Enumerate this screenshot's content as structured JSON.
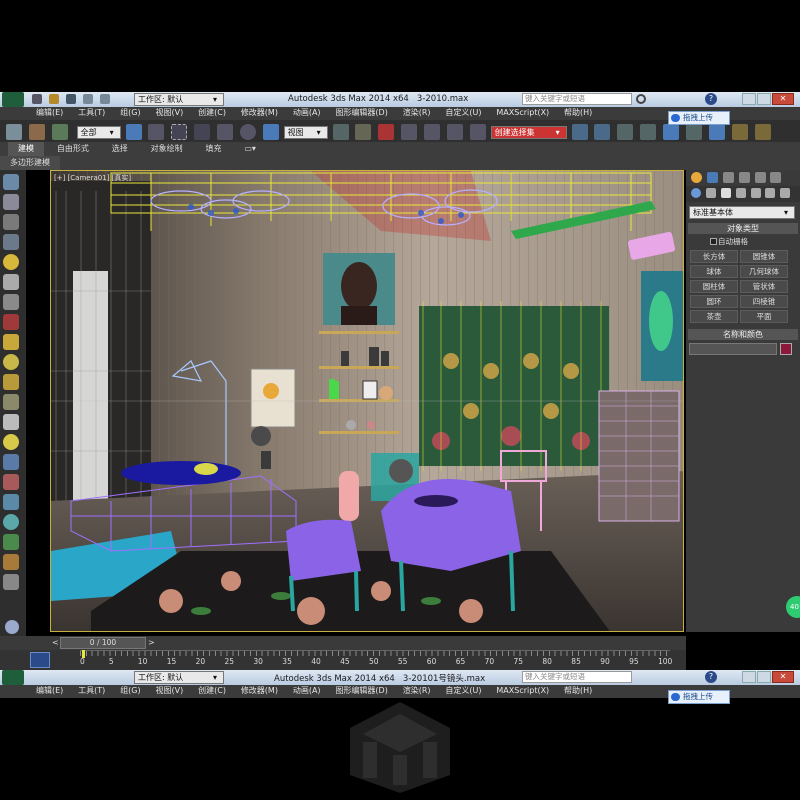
{
  "top": {
    "titlebar": {
      "workspace_label": "工作区: 默认",
      "app_title": "Autodesk 3ds Max  2014 x64",
      "file_name": "3-2010.max",
      "search_placeholder": "键入关键字或短语"
    },
    "menu": [
      "编辑(E)",
      "工具(T)",
      "组(G)",
      "视图(V)",
      "创建(C)",
      "修改器(M)",
      "动画(A)",
      "图形编辑器(D)",
      "渲染(R)",
      "自定义(U)",
      "MAXScript(X)",
      "帮助(H)"
    ],
    "toolbar": {
      "selection_filter": "全部",
      "ref_coord": "视图",
      "selection_set": "创建选择集",
      "cloud_upload": "拖拽上传"
    },
    "ribbon_tabs": [
      "建模",
      "自由形式",
      "选择",
      "对象绘制",
      "填充"
    ],
    "ribbon_sub": "多边形建模",
    "viewport_label": "[+] [Camera01] [真实]"
  },
  "command_panel": {
    "dropdown": "标准基本体",
    "object_type_title": "对象类型",
    "autogrid_label": "自动栅格",
    "buttons": [
      "长方体",
      "圆锥体",
      "球体",
      "几何球体",
      "圆柱体",
      "管状体",
      "圆环",
      "四棱锥",
      "茶壶",
      "平面"
    ],
    "name_color_title": "名称和颜色",
    "object_color": "#8b1a3a"
  },
  "timeline": {
    "frame_counter": "0 / 100",
    "ticks": [
      "0",
      "5",
      "10",
      "15",
      "20",
      "25",
      "30",
      "35",
      "40",
      "45",
      "50",
      "55",
      "60",
      "65",
      "70",
      "75",
      "80",
      "85",
      "90",
      "95",
      "100"
    ]
  },
  "bottom": {
    "titlebar": {
      "workspace_label": "工作区: 默认",
      "app_title": "Autodesk 3ds Max  2014 x64",
      "file_name": "3-20101号镜头.max",
      "search_placeholder": "键入关键字或短语"
    },
    "menu": [
      "编辑(E)",
      "工具(T)",
      "组(G)",
      "视图(V)",
      "创建(C)",
      "修改器(M)",
      "动画(A)",
      "图形编辑器(D)",
      "渲染(R)",
      "自定义(U)",
      "MAXScript(X)",
      "帮助(H)"
    ],
    "cloud_upload": "拖拽上传"
  },
  "side_badge": "40",
  "colors": {
    "wire_yellow": "#e8e83a",
    "wire_purple": "#a070ff",
    "chair_purple": "#8a63e6",
    "accent_green": "#2ecc71",
    "teal": "#2aa6a0"
  }
}
